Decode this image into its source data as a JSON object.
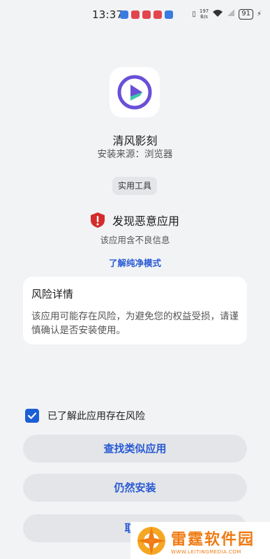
{
  "status_bar": {
    "time": "13:37",
    "network_speed_value": "197",
    "network_speed_unit": "B/s",
    "battery": "91"
  },
  "app": {
    "name": "清风影刻",
    "source": "安装来源：浏览器",
    "category_chip": "实用工具",
    "icon": "play-icon",
    "icon_color": "#6a4fd8",
    "icon_accent": "#3ec9a6"
  },
  "warning": {
    "icon": "shield-alert-icon",
    "title": "发现恶意应用",
    "subtitle": "该应用含不良信息",
    "link": "了解纯净模式",
    "color": "#d42c2c"
  },
  "risk_card": {
    "title": "风险详情",
    "description": "该应用可能存在风险，为避免您的权益受损，请谨慎确认是否安装使用。"
  },
  "acknowledge": {
    "label": "已了解此应用存在风险",
    "checked": true
  },
  "buttons": {
    "find_similar": "查找类似应用",
    "install_anyway": "仍然安装",
    "cancel": "取消"
  },
  "watermark": {
    "cn": "雷霆软件园",
    "en": "WWW.LEITINGMEDIA.COM"
  },
  "colors": {
    "accent": "#2a5ad4",
    "background": "#f1f3f5",
    "checkbox": "#1c5ed6"
  }
}
